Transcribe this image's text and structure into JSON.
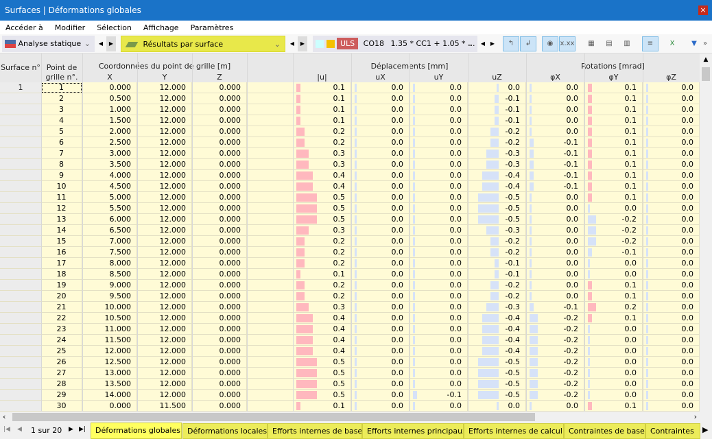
{
  "window": {
    "title": "Surfaces | Déformations globales",
    "close": "×"
  },
  "menu": [
    "Accéder à",
    "Modifier",
    "Sélection",
    "Affichage",
    "Paramètres"
  ],
  "toolbar": {
    "analysis": "Analyse statique",
    "results": "Résultats par surface",
    "uls": "ULS",
    "combo": "CO18",
    "formula": "1.35 * CC1 + 1.05 * ...",
    "colors": {
      "swatch1": "#ccffff",
      "swatch2": "#f5c000",
      "uls": "#cd5c5c",
      "highlight": "#e8e84a"
    }
  },
  "headers": {
    "surface": "Surface n°",
    "point": "Point de grille n°.",
    "coords": "Coordonnées du point de grille [m]",
    "x": "X",
    "y": "Y",
    "z": "Z",
    "disp": "Déplacements [mm]",
    "u": "|u|",
    "ux": "uX",
    "uy": "uY",
    "uz": "uZ",
    "rot": "Rotations [mrad]",
    "px": "φX",
    "py": "φY",
    "pz": "φZ"
  },
  "surface_no": "1",
  "rows": [
    [
      "1",
      "0.000",
      "12.000",
      "0.000",
      "0.1",
      "0.0",
      "0.0",
      "0.0",
      "0.0",
      "0.1",
      "0.0"
    ],
    [
      "2",
      "0.500",
      "12.000",
      "0.000",
      "0.1",
      "0.0",
      "0.0",
      "-0.1",
      "0.0",
      "0.1",
      "0.0"
    ],
    [
      "3",
      "1.000",
      "12.000",
      "0.000",
      "0.1",
      "0.0",
      "0.0",
      "-0.1",
      "0.0",
      "0.1",
      "0.0"
    ],
    [
      "4",
      "1.500",
      "12.000",
      "0.000",
      "0.1",
      "0.0",
      "0.0",
      "-0.1",
      "0.0",
      "0.1",
      "0.0"
    ],
    [
      "5",
      "2.000",
      "12.000",
      "0.000",
      "0.2",
      "0.0",
      "0.0",
      "-0.2",
      "0.0",
      "0.1",
      "0.0"
    ],
    [
      "6",
      "2.500",
      "12.000",
      "0.000",
      "0.2",
      "0.0",
      "0.0",
      "-0.2",
      "-0.1",
      "0.1",
      "0.0"
    ],
    [
      "7",
      "3.000",
      "12.000",
      "0.000",
      "0.3",
      "0.0",
      "0.0",
      "-0.3",
      "-0.1",
      "0.1",
      "0.0"
    ],
    [
      "8",
      "3.500",
      "12.000",
      "0.000",
      "0.3",
      "0.0",
      "0.0",
      "-0.3",
      "-0.1",
      "0.1",
      "0.0"
    ],
    [
      "9",
      "4.000",
      "12.000",
      "0.000",
      "0.4",
      "0.0",
      "0.0",
      "-0.4",
      "-0.1",
      "0.1",
      "0.0"
    ],
    [
      "10",
      "4.500",
      "12.000",
      "0.000",
      "0.4",
      "0.0",
      "0.0",
      "-0.4",
      "-0.1",
      "0.1",
      "0.0"
    ],
    [
      "11",
      "5.000",
      "12.000",
      "0.000",
      "0.5",
      "0.0",
      "0.0",
      "-0.5",
      "0.0",
      "0.1",
      "0.0"
    ],
    [
      "12",
      "5.500",
      "12.000",
      "0.000",
      "0.5",
      "0.0",
      "0.0",
      "-0.5",
      "0.0",
      "0.0",
      "0.0"
    ],
    [
      "13",
      "6.000",
      "12.000",
      "0.000",
      "0.5",
      "0.0",
      "0.0",
      "-0.5",
      "0.0",
      "-0.2",
      "0.0"
    ],
    [
      "14",
      "6.500",
      "12.000",
      "0.000",
      "0.3",
      "0.0",
      "0.0",
      "-0.3",
      "0.0",
      "-0.2",
      "0.0"
    ],
    [
      "15",
      "7.000",
      "12.000",
      "0.000",
      "0.2",
      "0.0",
      "0.0",
      "-0.2",
      "0.0",
      "-0.2",
      "0.0"
    ],
    [
      "16",
      "7.500",
      "12.000",
      "0.000",
      "0.2",
      "0.0",
      "0.0",
      "-0.2",
      "0.0",
      "-0.1",
      "0.0"
    ],
    [
      "17",
      "8.000",
      "12.000",
      "0.000",
      "0.2",
      "0.0",
      "0.0",
      "-0.1",
      "0.0",
      "0.0",
      "0.0"
    ],
    [
      "18",
      "8.500",
      "12.000",
      "0.000",
      "0.1",
      "0.0",
      "0.0",
      "-0.1",
      "0.0",
      "0.0",
      "0.0"
    ],
    [
      "19",
      "9.000",
      "12.000",
      "0.000",
      "0.2",
      "0.0",
      "0.0",
      "-0.2",
      "0.0",
      "0.1",
      "0.0"
    ],
    [
      "20",
      "9.500",
      "12.000",
      "0.000",
      "0.2",
      "0.0",
      "0.0",
      "-0.2",
      "0.0",
      "0.1",
      "0.0"
    ],
    [
      "21",
      "10.000",
      "12.000",
      "0.000",
      "0.3",
      "0.0",
      "0.0",
      "-0.3",
      "-0.1",
      "0.2",
      "0.0"
    ],
    [
      "22",
      "10.500",
      "12.000",
      "0.000",
      "0.4",
      "0.0",
      "0.0",
      "-0.4",
      "-0.2",
      "0.1",
      "0.0"
    ],
    [
      "23",
      "11.000",
      "12.000",
      "0.000",
      "0.4",
      "0.0",
      "0.0",
      "-0.4",
      "-0.2",
      "0.0",
      "0.0"
    ],
    [
      "24",
      "11.500",
      "12.000",
      "0.000",
      "0.4",
      "0.0",
      "0.0",
      "-0.4",
      "-0.2",
      "0.0",
      "0.0"
    ],
    [
      "25",
      "12.000",
      "12.000",
      "0.000",
      "0.4",
      "0.0",
      "0.0",
      "-0.4",
      "-0.2",
      "0.0",
      "0.0"
    ],
    [
      "26",
      "12.500",
      "12.000",
      "0.000",
      "0.5",
      "0.0",
      "0.0",
      "-0.5",
      "-0.2",
      "0.0",
      "0.0"
    ],
    [
      "27",
      "13.000",
      "12.000",
      "0.000",
      "0.5",
      "0.0",
      "0.0",
      "-0.5",
      "-0.2",
      "0.0",
      "0.0"
    ],
    [
      "28",
      "13.500",
      "12.000",
      "0.000",
      "0.5",
      "0.0",
      "0.0",
      "-0.5",
      "-0.2",
      "0.0",
      "0.0"
    ],
    [
      "29",
      "14.000",
      "12.000",
      "0.000",
      "0.5",
      "0.0",
      "-0.1",
      "-0.5",
      "-0.2",
      "0.0",
      "0.0"
    ],
    [
      "30",
      "0.000",
      "11.500",
      "0.000",
      "0.1",
      "0.0",
      "0.0",
      "0.0",
      "0.0",
      "0.1",
      "0.0"
    ]
  ],
  "pager": {
    "text": "1 sur 20"
  },
  "tabs": [
    "Déformations globales",
    "Déformations locales",
    "Efforts internes de base",
    "Efforts internes principaux",
    "Efforts internes de calcul",
    "Contraintes de base",
    "Contraintes"
  ]
}
